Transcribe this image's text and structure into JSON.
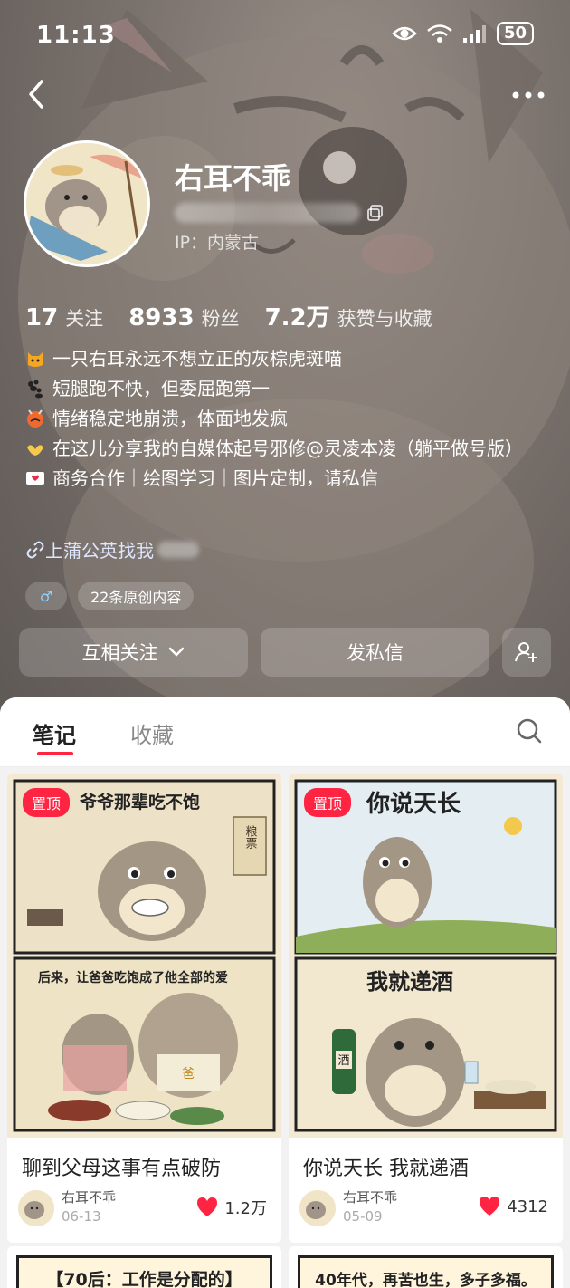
{
  "status_bar": {
    "time": "11:13",
    "battery": "50"
  },
  "profile": {
    "name": "右耳不乖",
    "ip": "IP：内蒙古"
  },
  "stats": [
    {
      "num": "17",
      "label": "关注"
    },
    {
      "num": "8933",
      "label": "粉丝"
    },
    {
      "num": "7.2万",
      "label": "获赞与收藏"
    }
  ],
  "bio": [
    "一只右耳永远不想立正的灰棕虎斑喵",
    "短腿跑不快，但委屈跑第一",
    "情绪稳定地崩溃，体面地发疯",
    "在这儿分享我的自媒体起号邪修@灵凌本凌（躺平做号版）",
    "商务合作｜绘图学习｜图片定制，请私信"
  ],
  "link_text": "上蒲公英找我",
  "tags": {
    "gender": "♂",
    "original": "22条原创内容"
  },
  "actions": {
    "follow": "互相关注",
    "message": "发私信"
  },
  "tabs": {
    "notes": "笔记",
    "collect": "收藏"
  },
  "cards": [
    {
      "pin": "置顶",
      "headline_top": "爷爷那辈吃不饱",
      "headline_bottom": "后来，让爸爸吃饱成了他全部的爱",
      "note_top": "粮票",
      "apron": "爸",
      "title": "聊到父母这事有点破防",
      "author": "右耳不乖",
      "date": "06-13",
      "likes": "1.2万"
    },
    {
      "pin": "置顶",
      "headline_top": "你说天长",
      "headline_bottom": "我就递酒",
      "bottle_label": "酒",
      "title": "你说天长 我就递酒",
      "author": "右耳不乖",
      "date": "05-09",
      "likes": "4312"
    },
    {
      "banner": "【70后：工作是分配的】"
    },
    {
      "banner": "40年代，再苦也生，多子多福。"
    }
  ],
  "colors": {
    "accent": "#ff2442",
    "hero_bg": "#7a726d"
  }
}
